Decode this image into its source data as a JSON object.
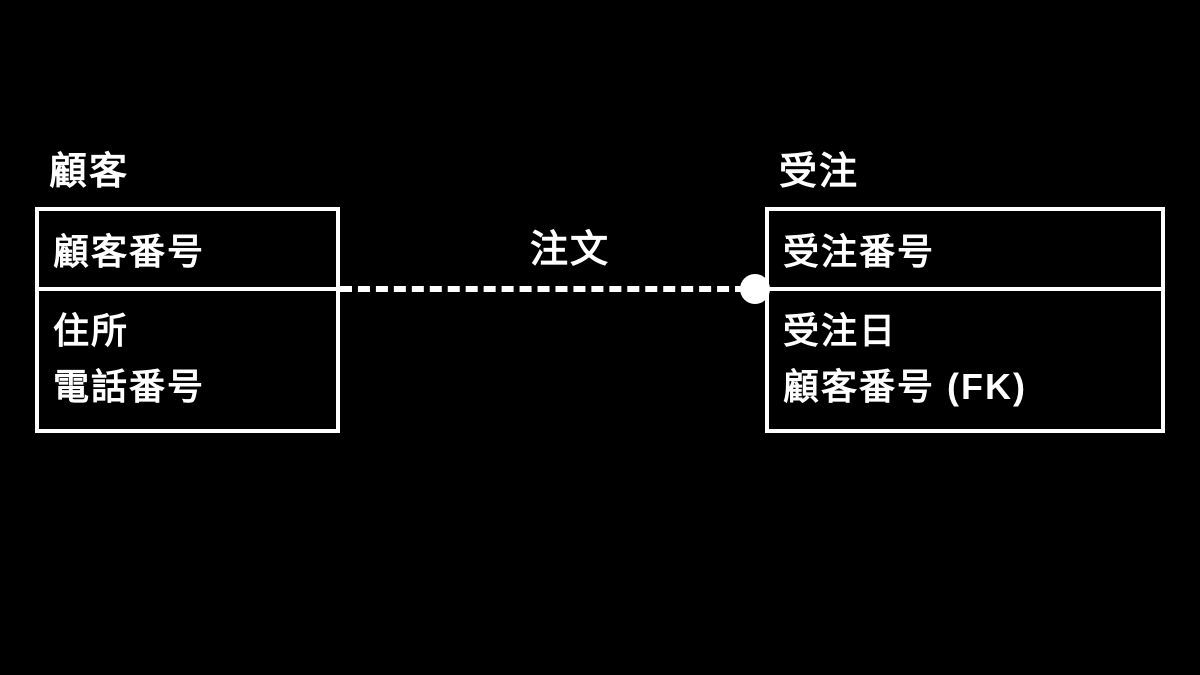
{
  "diagram": {
    "relationship_label": "注文",
    "entities": {
      "left": {
        "name": "顧客",
        "pk": "顧客番号",
        "attrs": [
          "住所",
          "電話番号"
        ]
      },
      "right": {
        "name": "受注",
        "pk": "受注番号",
        "attrs": [
          "受注日",
          "顧客番号 (FK)"
        ]
      }
    }
  }
}
